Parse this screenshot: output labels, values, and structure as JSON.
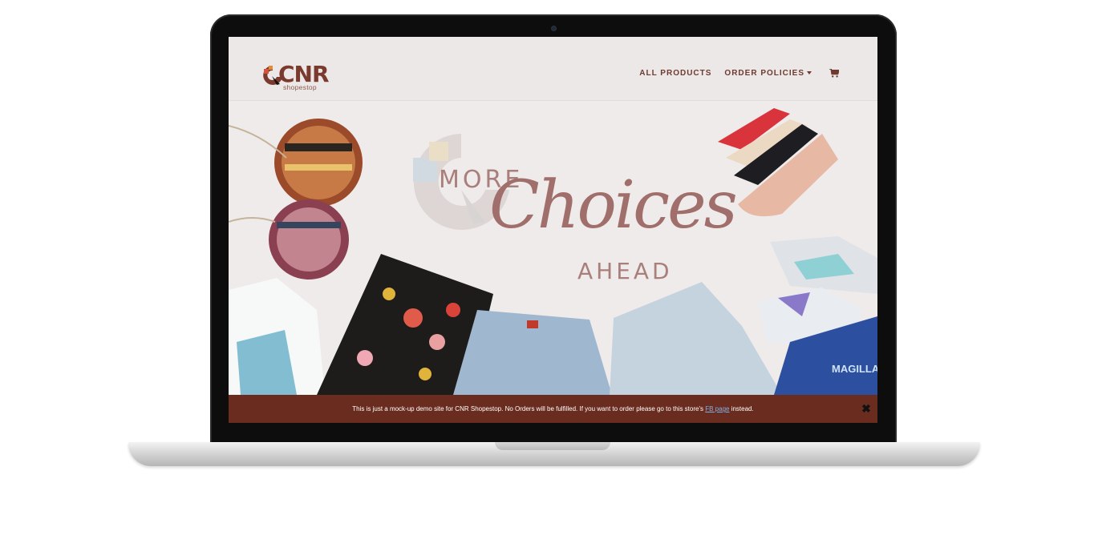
{
  "brand": {
    "name": "CNR",
    "subtitle": "shopestop",
    "colors": {
      "primary": "#6a2c1f",
      "accent": "#a06f6c",
      "background": "#efebea"
    }
  },
  "nav": {
    "items": [
      {
        "label": "ALL PRODUCTS"
      },
      {
        "label": "ORDER POLICIES",
        "has_dropdown": true
      }
    ],
    "cart_icon": "shopping-cart-icon"
  },
  "hero": {
    "line1": "MORE",
    "line2": "Choices",
    "line3": "AHEAD",
    "products": [
      "handbags",
      "heels",
      "sneakers",
      "floral-shorts",
      "denim-shorts",
      "t-shirts"
    ]
  },
  "notice": {
    "text_before": "This is just a mock-up demo site for CNR Shopestop. No Orders will be fulfilled. If you want to order please go to this store's ",
    "link_text": "FB page",
    "text_after": " instead.",
    "close_label": "✖"
  }
}
